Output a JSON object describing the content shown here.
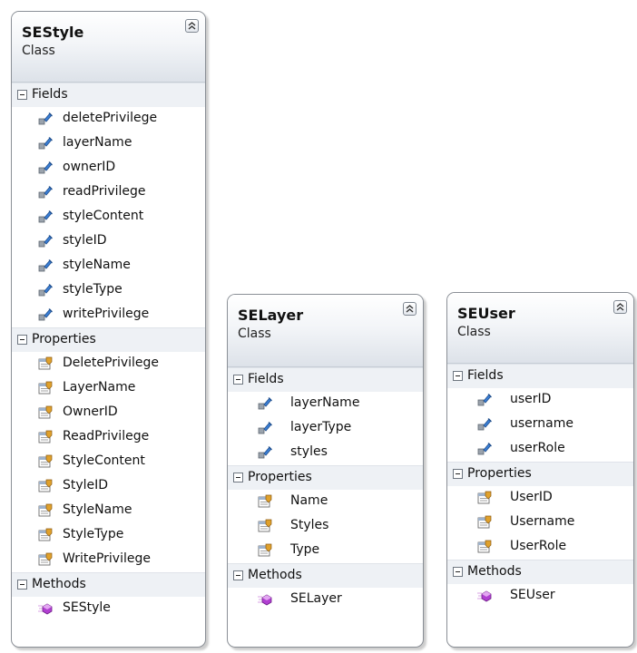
{
  "classes": [
    {
      "name": "SEStyle",
      "kind": "Class",
      "sections": [
        {
          "title": "Fields",
          "items": [
            "deletePrivilege",
            "layerName",
            "ownerID",
            "readPrivilege",
            "styleContent",
            "styleID",
            "styleName",
            "styleType",
            "writePrivilege"
          ]
        },
        {
          "title": "Properties",
          "items": [
            "DeletePrivilege",
            "LayerName",
            "OwnerID",
            "ReadPrivilege",
            "StyleContent",
            "StyleID",
            "StyleName",
            "StyleType",
            "WritePrivilege"
          ]
        },
        {
          "title": "Methods",
          "items": [
            "SEStyle"
          ]
        }
      ]
    },
    {
      "name": "SELayer",
      "kind": "Class",
      "sections": [
        {
          "title": "Fields",
          "items": [
            "layerName",
            "layerType",
            "styles"
          ]
        },
        {
          "title": "Properties",
          "items": [
            "Name",
            "Styles",
            "Type"
          ]
        },
        {
          "title": "Methods",
          "items": [
            "SELayer"
          ]
        }
      ]
    },
    {
      "name": "SEUser",
      "kind": "Class",
      "sections": [
        {
          "title": "Fields",
          "items": [
            "userID",
            "username",
            "userRole"
          ]
        },
        {
          "title": "Properties",
          "items": [
            "UserID",
            "Username",
            "UserRole"
          ]
        },
        {
          "title": "Methods",
          "items": [
            "SEUser"
          ]
        }
      ]
    }
  ],
  "icons": {
    "field": "field-icon",
    "property": "property-icon",
    "method": "method-icon",
    "collapse": "collapse-chevron-icon"
  },
  "colors": {
    "header_gradient_bottom": "#dde2e9",
    "section_bg": "#eef1f5",
    "border": "#8a8f96",
    "method_icon": "#b13fd1",
    "field_icon": "#3b7fd6",
    "property_icon": "#e0a12c"
  }
}
